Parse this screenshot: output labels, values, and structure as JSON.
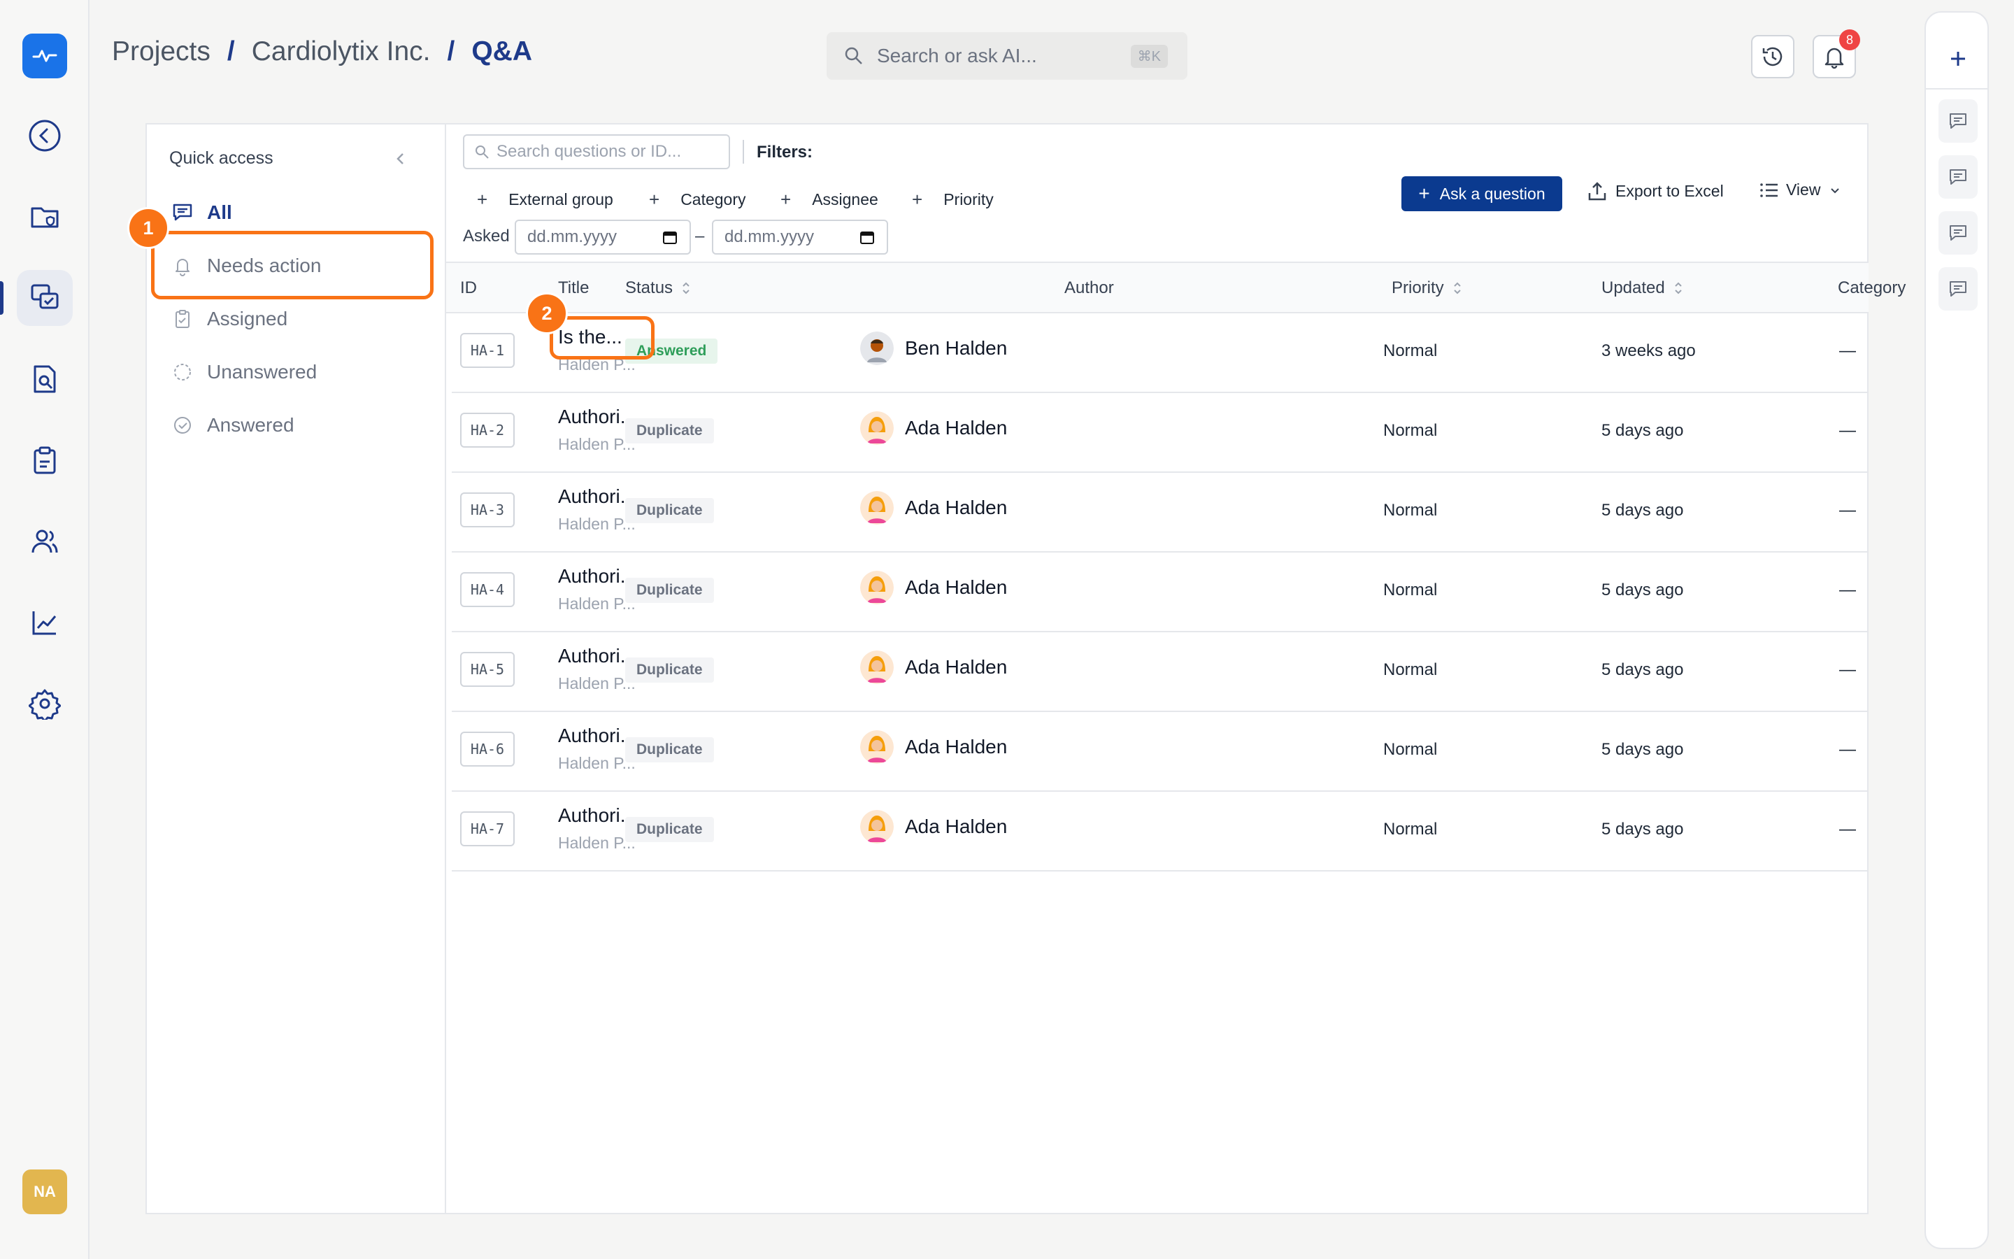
{
  "breadcrumb": {
    "projects": "Projects",
    "sep1": "/",
    "company": "Cardiolytix Inc.",
    "sep2": "/",
    "current": "Q&A"
  },
  "search": {
    "placeholder": "Search or ask AI...",
    "shortcut": "⌘K"
  },
  "notifications": {
    "count": "8"
  },
  "user": {
    "initials": "NA"
  },
  "quick_access": {
    "title": "Quick access",
    "items": [
      {
        "label": "All",
        "icon": "chat-list-icon"
      },
      {
        "label": "Needs action",
        "icon": "bell-icon"
      },
      {
        "label": "Assigned",
        "icon": "clipboard-check-icon"
      },
      {
        "label": "Unanswered",
        "icon": "dashed-circle-icon"
      },
      {
        "label": "Answered",
        "icon": "check-circle-icon"
      }
    ]
  },
  "callouts": {
    "one": "1",
    "two": "2"
  },
  "toolbar": {
    "search_placeholder": "Search questions or ID...",
    "filters_label": "Filters:",
    "filter_plus": "+",
    "filters": [
      "External group",
      "Category",
      "Assignee",
      "Priority"
    ],
    "asked_label": "Asked",
    "date_from_placeholder": "dd.mm.yyyy",
    "date_to_placeholder": "dd.mm.yyyy",
    "date_dash": "–",
    "ask_button": "Ask a question",
    "ask_plus": "+",
    "export_button": "Export to Excel",
    "view_button": "View"
  },
  "table": {
    "headers": {
      "id": "ID",
      "title": "Title",
      "status": "Status",
      "author": "Author",
      "priority": "Priority",
      "updated": "Updated",
      "category": "Category"
    },
    "rows": [
      {
        "id": "HA-1",
        "title": "Is the...",
        "subtitle": "Halden P...",
        "status": "Answered",
        "author": "Ben Halden",
        "priority": "Normal",
        "updated": "3 weeks ago",
        "category": "—"
      },
      {
        "id": "HA-2",
        "title": "Authori...",
        "subtitle": "Halden P...",
        "status": "Duplicate",
        "author": "Ada Halden",
        "priority": "Normal",
        "updated": "5 days ago",
        "category": "—"
      },
      {
        "id": "HA-3",
        "title": "Authori...",
        "subtitle": "Halden P...",
        "status": "Duplicate",
        "author": "Ada Halden",
        "priority": "Normal",
        "updated": "5 days ago",
        "category": "—"
      },
      {
        "id": "HA-4",
        "title": "Authori...",
        "subtitle": "Halden P...",
        "status": "Duplicate",
        "author": "Ada Halden",
        "priority": "Normal",
        "updated": "5 days ago",
        "category": "—"
      },
      {
        "id": "HA-5",
        "title": "Authori...",
        "subtitle": "Halden P...",
        "status": "Duplicate",
        "author": "Ada Halden",
        "priority": "Normal",
        "updated": "5 days ago",
        "category": "—"
      },
      {
        "id": "HA-6",
        "title": "Authori...",
        "subtitle": "Halden P...",
        "status": "Duplicate",
        "author": "Ada Halden",
        "priority": "Normal",
        "updated": "5 days ago",
        "category": "—"
      },
      {
        "id": "HA-7",
        "title": "Authori...",
        "subtitle": "Halden P...",
        "status": "Duplicate",
        "author": "Ada Halden",
        "priority": "Normal",
        "updated": "5 days ago",
        "category": "—"
      }
    ]
  },
  "colors": {
    "accent": "#1e3a8a",
    "primary_button": "#0b3a8f",
    "highlight": "#f97316",
    "answered": "#2f9e5a"
  }
}
